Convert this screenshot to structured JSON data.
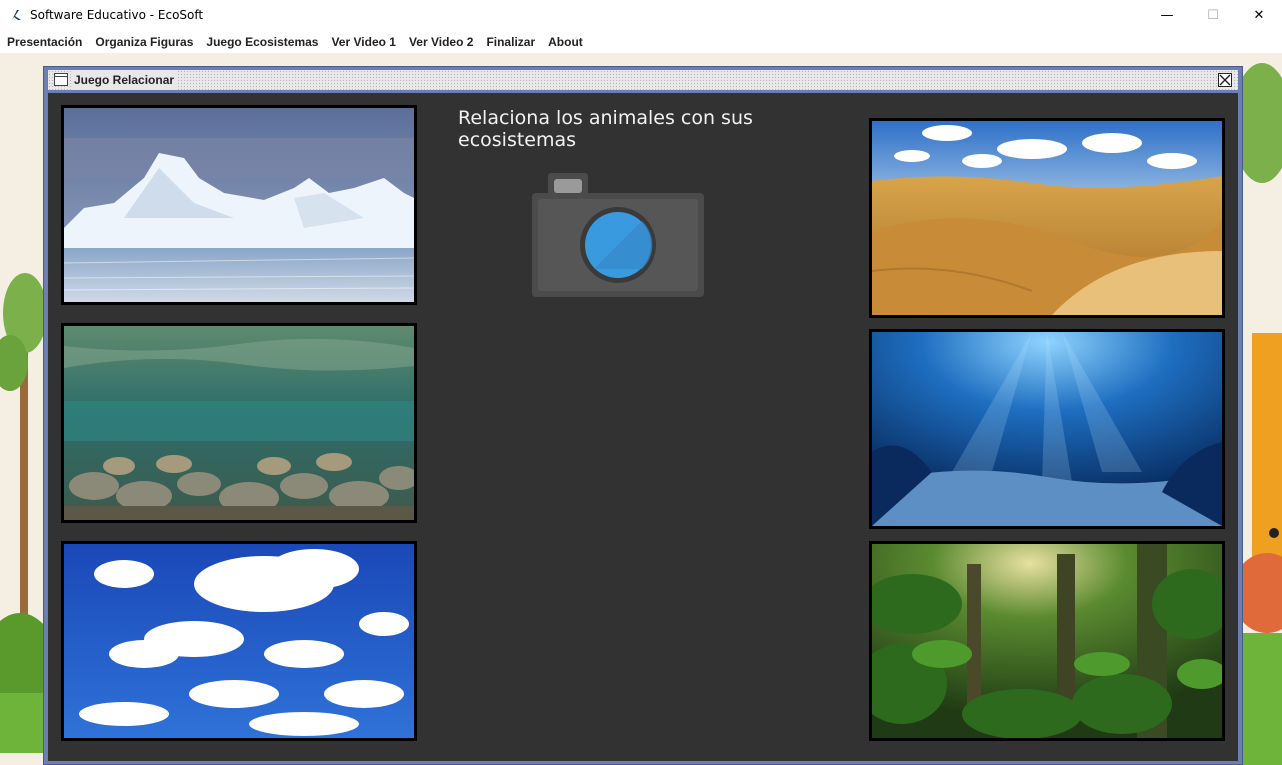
{
  "window": {
    "title": "Software Educativo - EcoSoft",
    "controls": {
      "minimize": "—",
      "maximize": "☐",
      "close": "✕"
    }
  },
  "menu": {
    "items": [
      "Presentación",
      "Organiza Figuras",
      "Juego Ecosistemas",
      "Ver Video 1",
      "Ver Video 2",
      "Finalizar",
      "About"
    ]
  },
  "internal_frame": {
    "title": "Juego Relacionar",
    "heading": "Relaciona los animales con sus ecosistemas"
  },
  "images": {
    "left": [
      "iceberg-image",
      "river-underwater-image",
      "sky-clouds-image"
    ],
    "right": [
      "desert-dunes-image",
      "ocean-deep-image",
      "jungle-forest-image"
    ],
    "center": "camera-placeholder-icon"
  },
  "colors": {
    "frame_border": "#6c7fb3",
    "content_bg": "#323232",
    "heading_text": "#f2f2f2",
    "camera_body": "#4b4b4b",
    "camera_lens": "#3a9ae0"
  }
}
